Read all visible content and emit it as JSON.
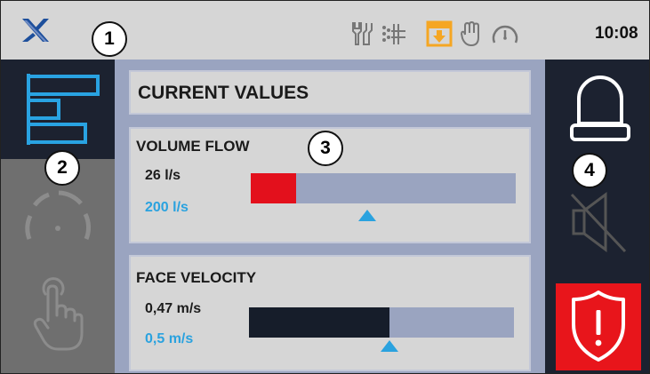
{
  "topbar": {
    "clock": "10:08",
    "status_icons": [
      "tools-icon",
      "airflow-icon",
      "download-icon",
      "hand-icon",
      "gauge-icon"
    ],
    "active_icon_color": "#f5a623"
  },
  "callouts": [
    "1",
    "2",
    "3",
    "4"
  ],
  "nav": {
    "items": [
      "values-bars-icon",
      "speedometer-icon",
      "touch-hand-icon"
    ],
    "active_color": "#29a3e2"
  },
  "main": {
    "title": "CURRENT VALUES",
    "volume_flow": {
      "label": "VOLUME FLOW",
      "current": "26 l/s",
      "target": "200 l/s",
      "fill_fraction": 0.17,
      "marker_fraction": 0.44,
      "fill_color": "#e3101c"
    },
    "face_velocity": {
      "label": "FACE VELOCITY",
      "current": "0,47 m/s",
      "target": "0,5 m/s",
      "fill_fraction": 0.53,
      "marker_fraction": 0.53,
      "fill_color": "#161d2a"
    }
  },
  "right": {
    "items": [
      "alarm-light-icon",
      "mute-icon",
      "warning-shield-icon"
    ],
    "alert_color": "#e8151b"
  }
}
